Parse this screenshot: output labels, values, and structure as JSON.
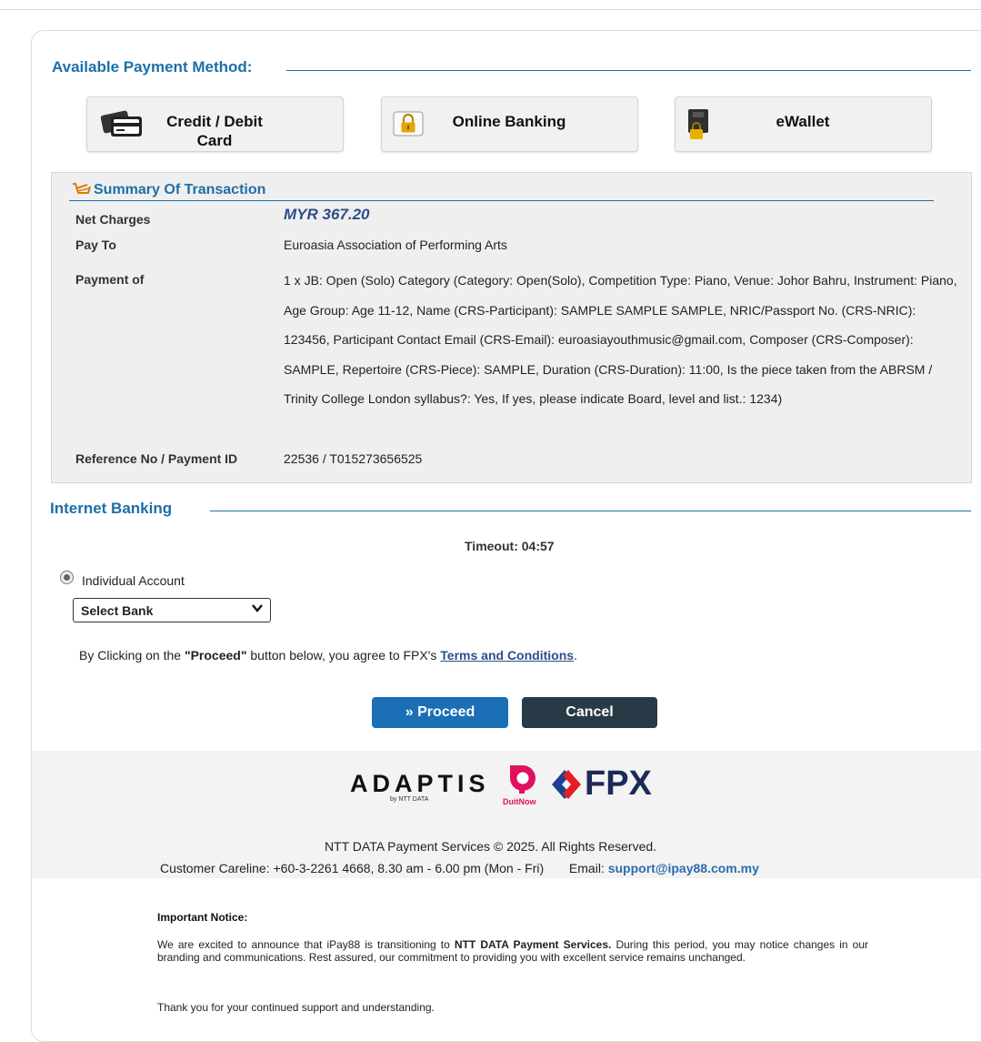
{
  "payment_methods": {
    "title": "Available Payment Method:",
    "options": [
      {
        "label_line1": "Credit / Debit",
        "label_line2": "Card",
        "icon": "credit-card-icon"
      },
      {
        "label": "Online Banking",
        "icon": "lock-icon"
      },
      {
        "label": "eWallet",
        "icon": "wallet-icon"
      }
    ]
  },
  "summary": {
    "title": "Summary Of Transaction",
    "icon": "cart-icon",
    "net_charges_label": "Net Charges",
    "net_charges_value": "MYR 367.20",
    "pay_to_label": "Pay To",
    "pay_to_value": "Euroasia Association of Performing Arts",
    "payment_of_label": "Payment of",
    "payment_of_value": "1 x JB: Open (Solo) Category (Category: Open(Solo), Competition Type: Piano, Venue: Johor Bahru, Instrument: Piano, Age Group: Age 11-12, Name (CRS-Participant): SAMPLE SAMPLE SAMPLE, NRIC/Passport No. (CRS-NRIC): 123456, Participant Contact Email (CRS-Email): euroasiayouthmusic@gmail.com, Composer (CRS-Composer): SAMPLE, Repertoire (CRS-Piece): SAMPLE, Duration (CRS-Duration): 11:00, Is the piece taken from the ABRSM / Trinity College London syllabus?: Yes, If yes, please indicate Board, level and list.: 1234)",
    "reference_label": "Reference No / Payment ID",
    "reference_value": "22536 / T015273656525"
  },
  "internet_banking": {
    "title": "Internet Banking",
    "timeout": "Timeout: 04:57",
    "account_type": "Individual Account",
    "bank_select_value": "Select Bank",
    "agree_prefix": "By Clicking on the ",
    "agree_bold": "\"Proceed\"",
    "agree_middle": " button below, you agree to FPX's ",
    "agree_link": "Terms and Conditions",
    "agree_suffix": ".",
    "proceed_label": "» Proceed",
    "cancel_label": "Cancel"
  },
  "footer": {
    "logo_adaptis": "ADAPTIS",
    "logo_adaptis_sub": "by NTT DATA",
    "logo_duitnow": "DuitNow",
    "logo_fpx": "FPX",
    "copyright": "NTT DATA Payment Services © 2025. All Rights Reserved.",
    "careline": "Customer Careline: +60-3-2261 4668, 8.30 am - 6.00 pm (Mon - Fri)",
    "email_label": "Email:",
    "email": "support@ipay88.com.my",
    "notice_title": "Important Notice:",
    "notice_prefix": "We are excited to announce that iPay88 is transitioning to ",
    "notice_bold": "NTT DATA Payment Services.",
    "notice_suffix": " During this period, you may notice changes in our branding and communications. Rest assured, our commitment to providing you with excellent service remains unchanged.",
    "notice_thanks": "Thank you for your continued support and understanding."
  },
  "colors": {
    "accent": "#1d6fa8",
    "proceed": "#1a6fb5",
    "cancel": "#283a46",
    "link": "#2d4e8a"
  }
}
